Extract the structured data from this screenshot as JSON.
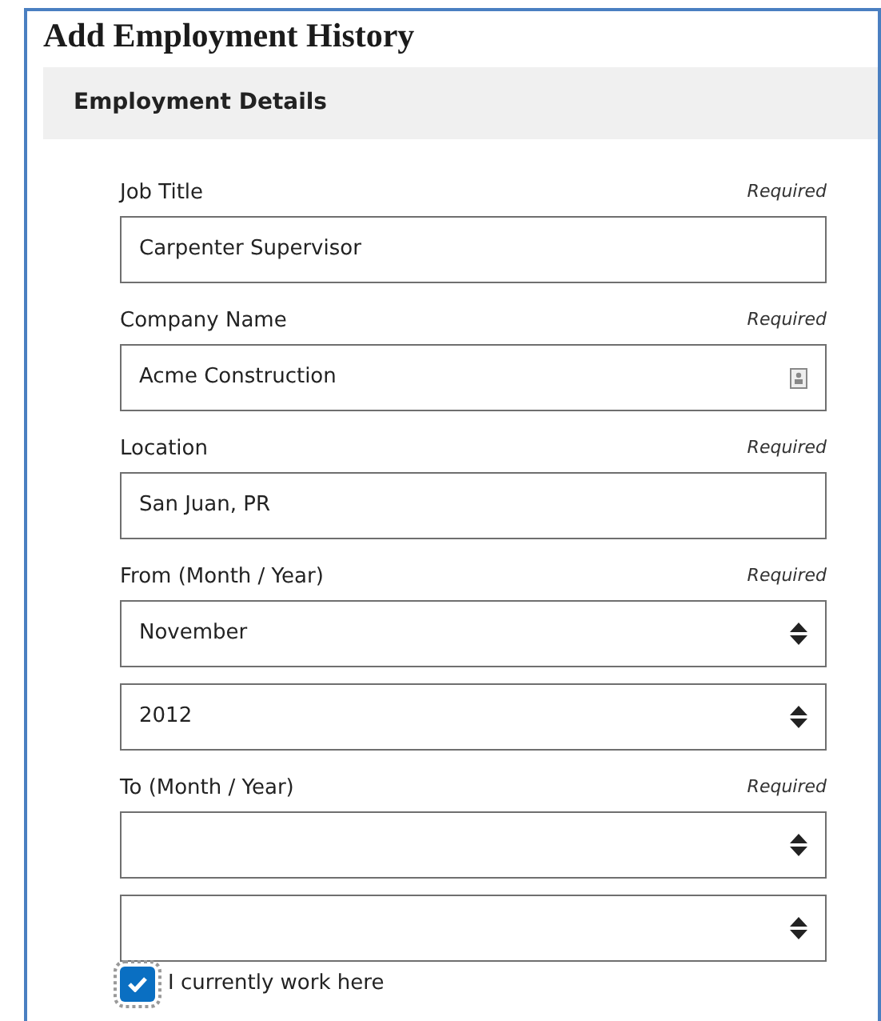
{
  "title": "Add Employment History",
  "section": {
    "heading": "Employment Details"
  },
  "fields": [
    {
      "label": "Job Title",
      "note": "Required",
      "inputs": [
        {
          "kind": "text",
          "value": "Carpenter Supervisor"
        }
      ]
    },
    {
      "label": "Company Name",
      "note": "Required",
      "inputs": [
        {
          "kind": "contact",
          "value": "Acme Construction"
        }
      ]
    },
    {
      "label": "Location",
      "note": "Required",
      "inputs": [
        {
          "kind": "text",
          "value": "San Juan, PR"
        }
      ]
    },
    {
      "label": "From (Month / Year)",
      "note": "Required",
      "inputs": [
        {
          "kind": "select",
          "value": "November"
        },
        {
          "kind": "select",
          "value": "2012"
        }
      ]
    },
    {
      "label": "To (Month / Year)",
      "note": "Required",
      "inputs": [
        {
          "kind": "select"
        },
        {
          "kind": "select"
        }
      ]
    }
  ],
  "checkbox": {
    "label": "I currently work here",
    "checked": true
  }
}
